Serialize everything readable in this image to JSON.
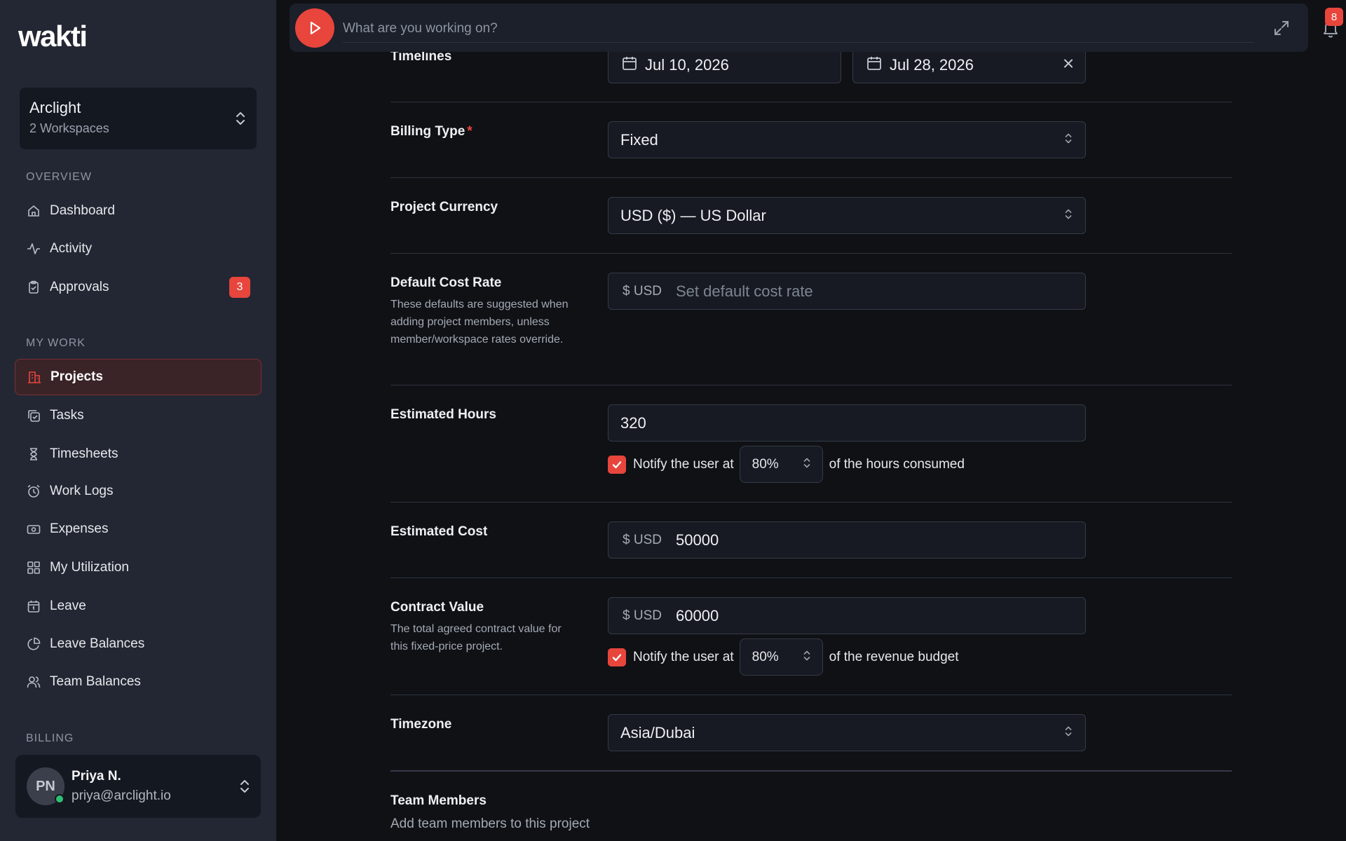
{
  "sidebar": {
    "logo": "wakti",
    "workspace": {
      "name": "Arclight",
      "subtitle": "2 Workspaces"
    },
    "sections": {
      "overview": "OVERVIEW",
      "my_work": "MY WORK",
      "billing": "BILLING"
    },
    "overview_items": [
      {
        "label": "Dashboard",
        "icon": "home-icon"
      },
      {
        "label": "Activity",
        "icon": "pulse-icon"
      },
      {
        "label": "Approvals",
        "icon": "clipboard-check-icon",
        "badge": "3"
      }
    ],
    "work_items": [
      {
        "label": "Projects",
        "icon": "building-icon",
        "active": true
      },
      {
        "label": "Tasks",
        "icon": "copy-check-icon"
      },
      {
        "label": "Timesheets",
        "icon": "hourglass-icon"
      },
      {
        "label": "Work Logs",
        "icon": "alarm-clock-icon"
      },
      {
        "label": "Expenses",
        "icon": "banknote-icon"
      },
      {
        "label": "My Utilization",
        "icon": "grid-icon"
      },
      {
        "label": "Leave",
        "icon": "calendar-icon"
      },
      {
        "label": "Leave Balances",
        "icon": "pie-chart-icon"
      },
      {
        "label": "Team Balances",
        "icon": "users-icon"
      }
    ],
    "user": {
      "initials": "PN",
      "name": "Priya N.",
      "email": "priya@arclight.io"
    }
  },
  "topbar": {
    "timer_placeholder": "What are you working on?",
    "notification_count": "8"
  },
  "form": {
    "timelines": {
      "label": "Timelines",
      "start": "Jul 10, 2026",
      "end": "Jul 28, 2026"
    },
    "billing_type": {
      "label": "Billing Type",
      "required_mark": "*",
      "value": "Fixed"
    },
    "currency": {
      "label": "Project Currency",
      "value": "USD ($) — US Dollar"
    },
    "cost_rate": {
      "label": "Default Cost Rate",
      "help": "These defaults are suggested when adding project members, unless member/workspace rates override.",
      "prefix": "$ USD",
      "placeholder": "Set default cost rate"
    },
    "estimated_hours": {
      "label": "Estimated Hours",
      "value": "320",
      "notify_prefix": "Notify the user at",
      "notify_pct": "80%",
      "notify_suffix": "of the hours consumed"
    },
    "estimated_cost": {
      "label": "Estimated Cost",
      "prefix": "$ USD",
      "value": "50000"
    },
    "contract_value": {
      "label": "Contract Value",
      "help": "The total agreed contract value for this fixed-price project.",
      "prefix": "$ USD",
      "value": "60000",
      "notify_prefix": "Notify the user at",
      "notify_pct": "80%",
      "notify_suffix": "of the revenue budget"
    },
    "timezone": {
      "label": "Timezone",
      "value": "Asia/Dubai"
    },
    "team_members": {
      "label": "Team Members",
      "subtitle": "Add team members to this project"
    }
  },
  "colors": {
    "accent": "#e8453c",
    "sidebar_bg": "#232733",
    "page_bg": "#0f1115",
    "online": "#2fbf71"
  }
}
